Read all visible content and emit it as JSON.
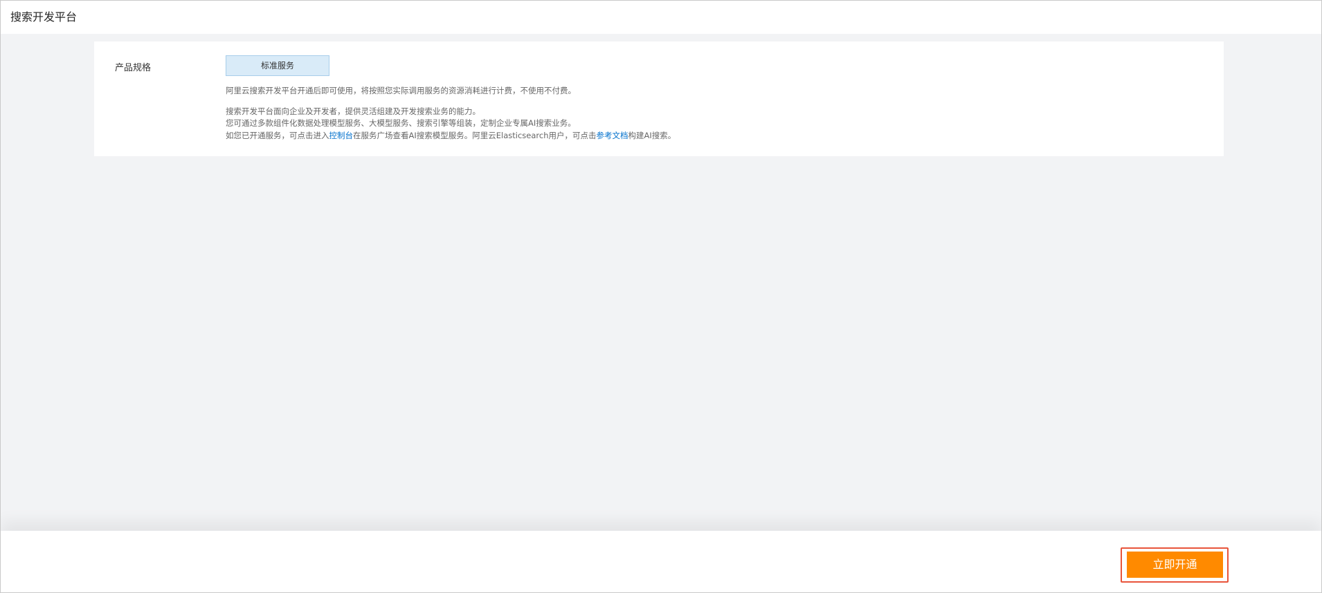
{
  "header": {
    "title": "搜索开发平台"
  },
  "spec": {
    "label": "产品规格",
    "selected_option": "标准服务"
  },
  "description": {
    "line1": "阿里云搜索开发平台开通后即可使用，将按照您实际调用服务的资源消耗进行计费，不使用不付费。",
    "line2": "搜索开发平台面向企业及开发者，提供灵活组建及开发搜索业务的能力。",
    "line3": "您可通过多款组件化数据处理模型服务、大模型服务、搜索引擎等组装，定制企业专属AI搜索业务。",
    "line4_part1": "如您已开通服务，可点击进入",
    "line4_link1": "控制台",
    "line4_part2": "在服务广场查看AI搜索模型服务。阿里云Elasticsearch用户，可点击",
    "line4_link2": "参考文档",
    "line4_part3": "构建AI搜索。"
  },
  "footer": {
    "activate_label": "立即开通"
  },
  "colors": {
    "accent_button": "#ff8a00",
    "highlight_outline": "#e8543a",
    "link": "#0070cc",
    "selected_option_bg": "#d9ebf8"
  }
}
